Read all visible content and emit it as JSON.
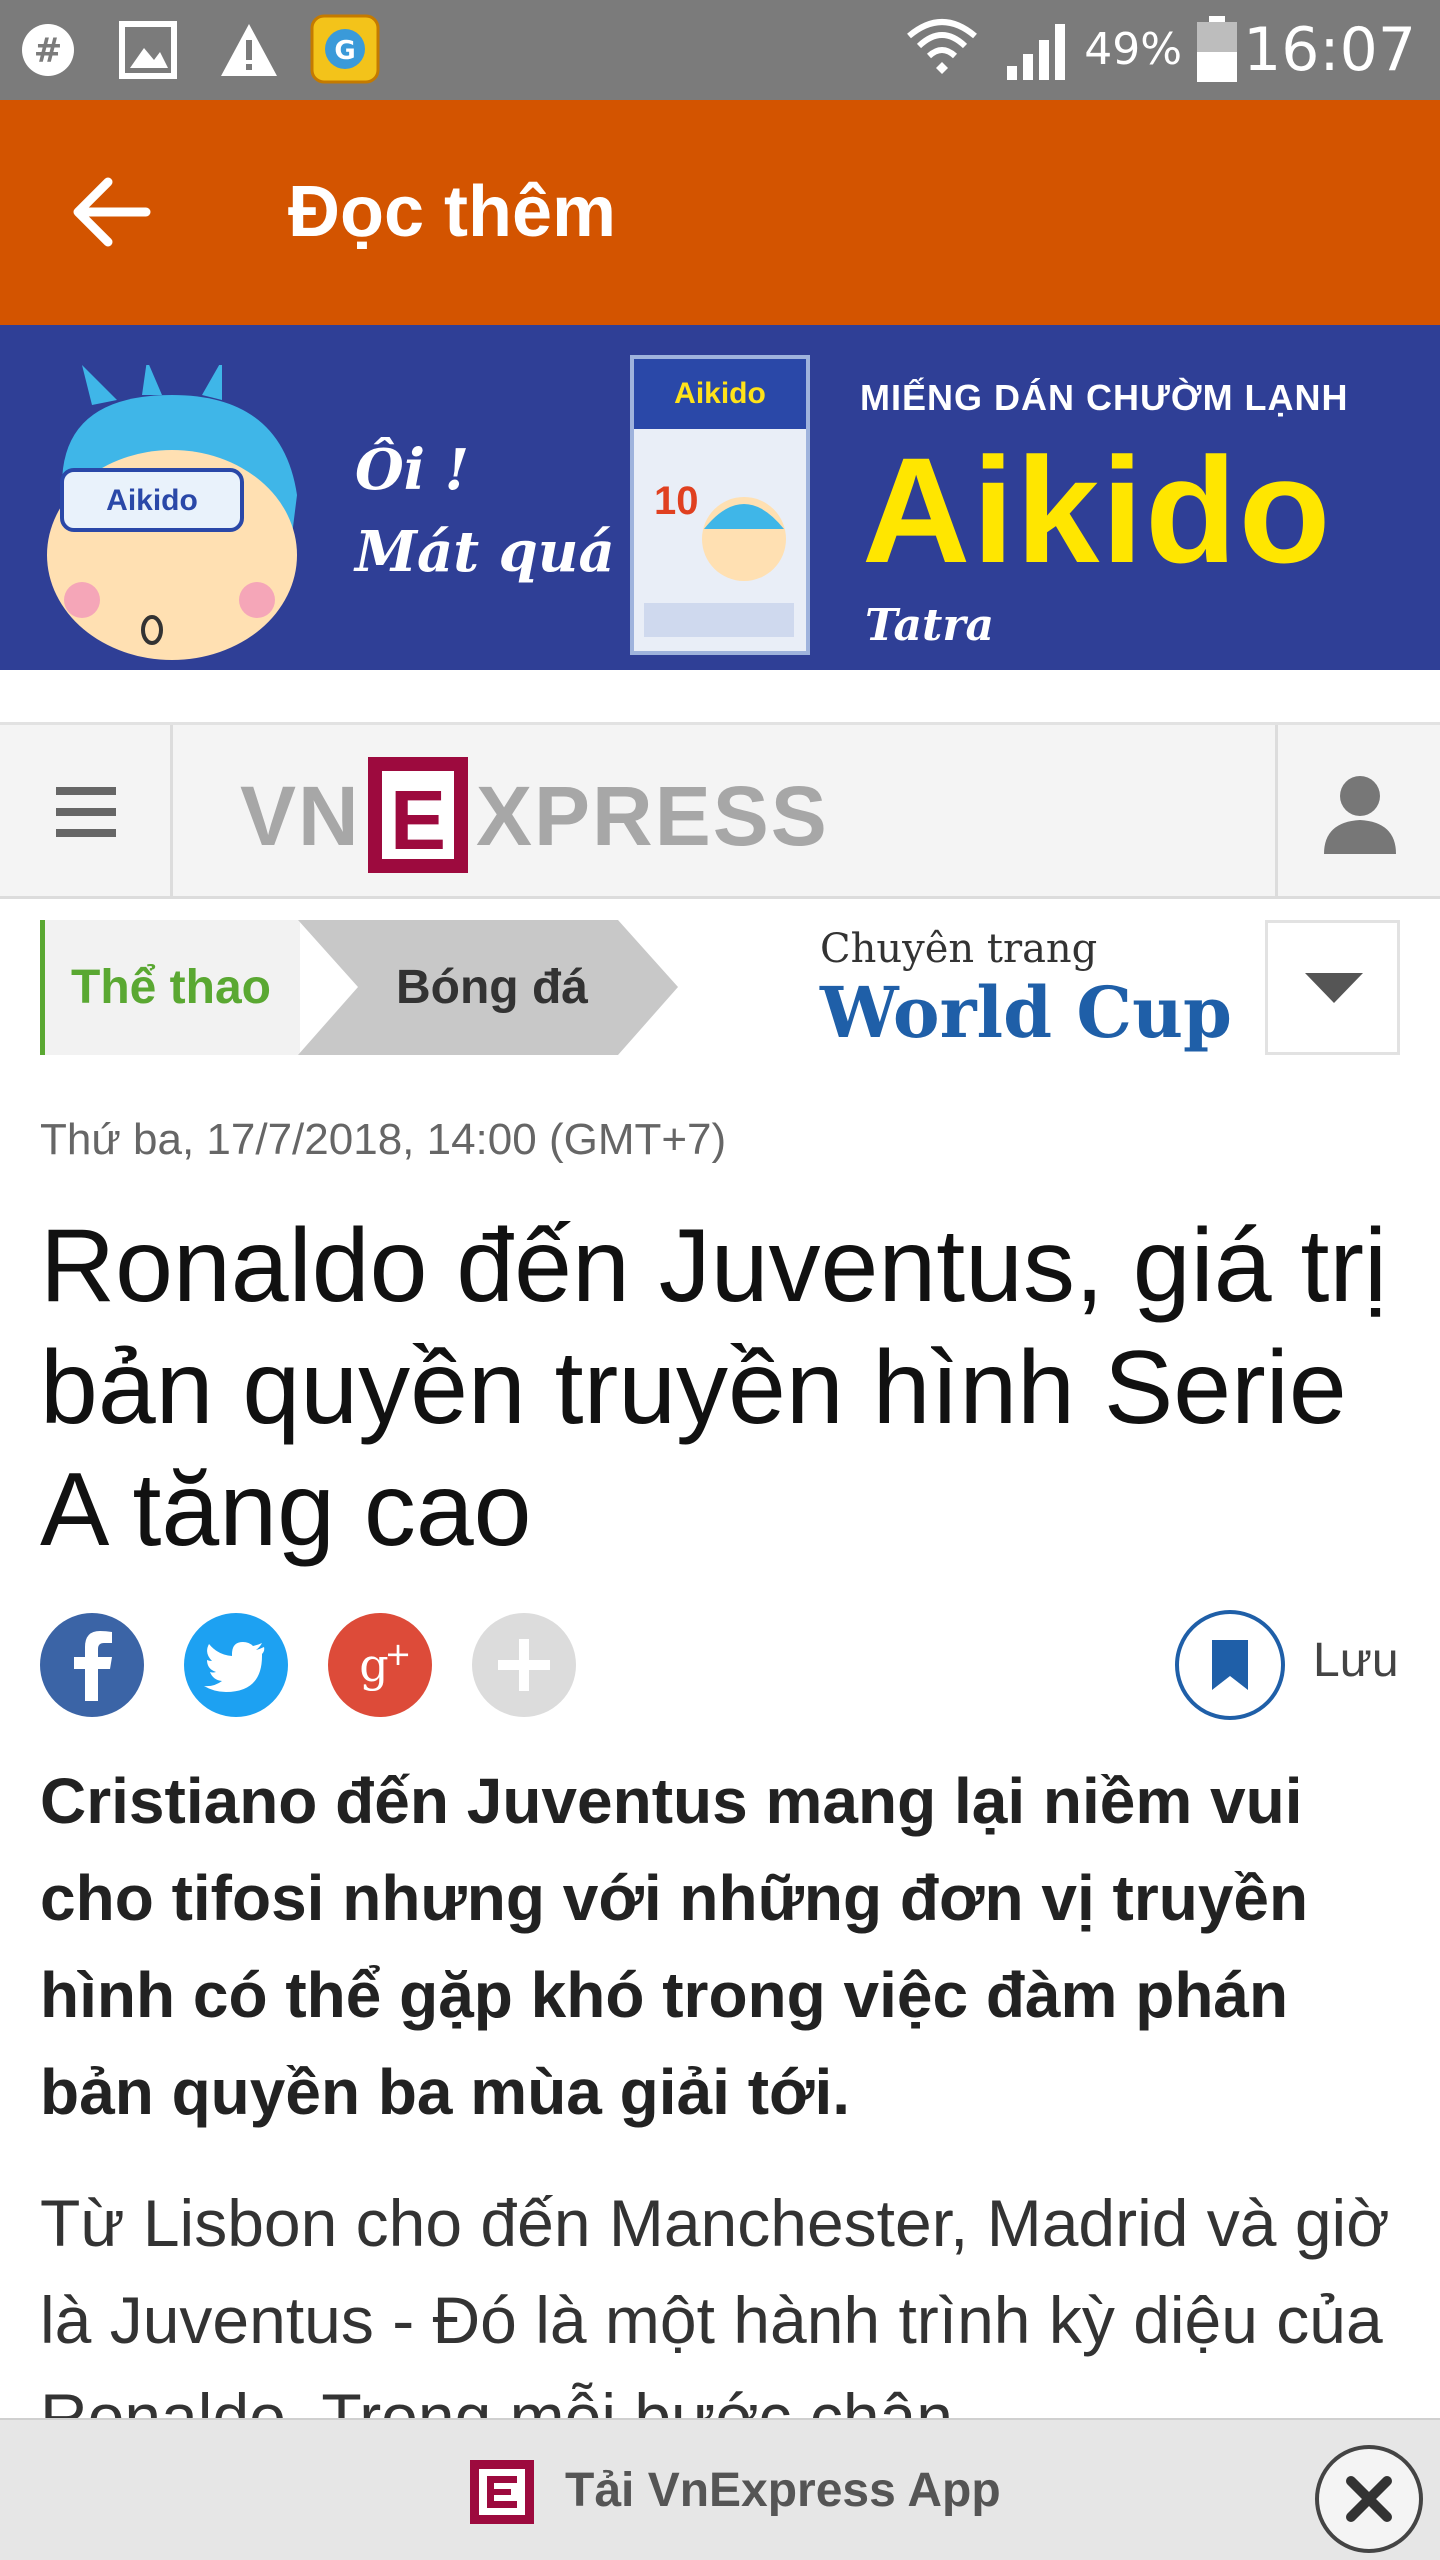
{
  "status_bar": {
    "icons": [
      "gear-icon",
      "image-icon",
      "warning-icon",
      "game-app-icon",
      "wifi-icon",
      "signal-icon",
      "battery-icon"
    ],
    "battery": "49%",
    "time": "16:07"
  },
  "app_bar": {
    "title": "Đọc thêm",
    "color": "#d35400"
  },
  "ad": {
    "badge": "Aikido",
    "slogan_1": "Ôi !",
    "slogan_2": "Mát quá",
    "pack_label": "Aikido",
    "pack_number": "10",
    "subtitle": "MIẾNG DÁN CHƯỜM LẠNH",
    "brand": "Aikido",
    "maker": "Tatra"
  },
  "site_header": {
    "logo_vn": "VN",
    "logo_e": "E",
    "logo_xpress": "XPRESS"
  },
  "breadcrumb": {
    "section": "Thể thao",
    "subsection": "Bóng đá"
  },
  "world_cup": {
    "line1": "Chuyên trang",
    "line2": "World Cup"
  },
  "article": {
    "date": "Thứ ba, 17/7/2018, 14:00 (GMT+7)",
    "headline": "Ronaldo đến Juventus, giá trị bản quyền truyền hình Serie A tăng cao",
    "save_label": "Lưu",
    "lead": "Cristiano đến Juventus mang lại niềm vui cho tifosi nhưng với những đơn vị truyền hình có thể gặp khó trong việc đàm phán bản quyền ba mùa giải tới.",
    "body": "Từ Lisbon cho đến Manchester, Madrid và giờ là Juventus - Đó là một hành trình kỳ diệu của Ronaldo. Trong mỗi bước chân"
  },
  "share_buttons": [
    "facebook-icon",
    "twitter-icon",
    "google-plus-icon",
    "more-share-icon"
  ],
  "app_banner": {
    "label": "Tải VnExpress App"
  },
  "colors": {
    "accent": "#d35400",
    "brand_red": "#c8102e",
    "sport_green": "#5aa832",
    "wc_blue": "#1f5fa8",
    "ad_bg": "#2f3f96",
    "ad_yellow": "#ffe600"
  }
}
